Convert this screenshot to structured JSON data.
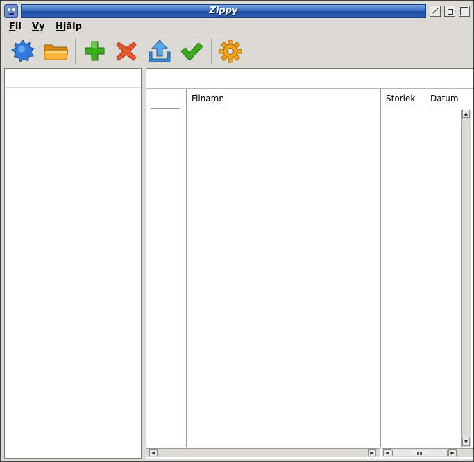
{
  "window": {
    "title": "Zippy",
    "app_icon": "zippy-app-icon"
  },
  "menu": {
    "items": [
      {
        "label": "Fil"
      },
      {
        "label": "Vy"
      },
      {
        "label": "Hjälp"
      }
    ]
  },
  "toolbar": {
    "buttons": [
      {
        "icon": "new-archive-icon",
        "color": "#2f7be0"
      },
      {
        "icon": "open-folder-icon",
        "color": "#f4a11a"
      },
      {
        "icon": "add-icon",
        "color": "#3cae1c"
      },
      {
        "icon": "delete-icon",
        "color": "#e8562a"
      },
      {
        "icon": "extract-icon",
        "color": "#3f8fd6"
      },
      {
        "icon": "test-icon",
        "color": "#3cae1c"
      },
      {
        "icon": "settings-icon",
        "color": "#f2a318"
      }
    ]
  },
  "file_list": {
    "columns": {
      "name": "Filnamn",
      "size": "Storlek",
      "date": "Datum"
    }
  }
}
